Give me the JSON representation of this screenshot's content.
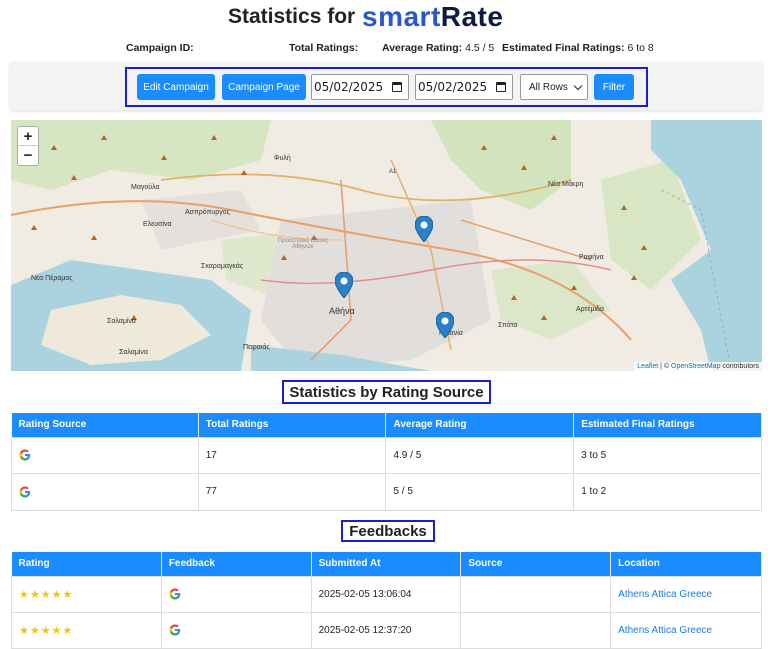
{
  "header": {
    "title": "Statistics for",
    "logo_smart": "smart",
    "logo_rate": "Rate"
  },
  "summary": {
    "campaign_id_label": "Campaign ID:",
    "campaign_id_value": "",
    "total_ratings_label": "Total Ratings:",
    "total_ratings_value": "",
    "average_rating_label": "Average Rating:",
    "average_rating_value": "4.5 / 5",
    "estimated_final_label": "Estimated Final Ratings:",
    "estimated_final_value": "6 to 8"
  },
  "controls": {
    "edit_campaign": "Edit Campaign",
    "campaign_page": "Campaign Page",
    "date_from": "05/02/2025",
    "date_to": "05/02/2025",
    "rows_select": "All Rows",
    "filter": "Filter"
  },
  "map": {
    "zoom_in": "+",
    "zoom_out": "−",
    "attribution_leaflet": "Leaflet",
    "attribution_sep": " | © ",
    "attribution_osm": "OpenStreetMap",
    "attribution_contrib": " contributors",
    "labels": {
      "fyli": "Φυλή",
      "magoula": "Μαγούλα",
      "aspropyrgos": "Ασπρόπυργος",
      "elefsina": "Ελευσίνα",
      "skaramagkas": "Σκαραμαγκάς",
      "nea_peramos": "Νέα Πέραμος",
      "salamina1": "Σαλαμίνα",
      "salamina2": "Σαλαμίνα",
      "peiraias": "Πειραιάς",
      "athina": "Αθήνα",
      "paiania": "Παιανία",
      "spata": "Σπάτα",
      "artemida": "Αρτέμιδα",
      "rafina": "Ραφήνα",
      "nea_makri": "Νέα Μάκρη",
      "forest": "Προαστιακό Δάσος Αθηνών",
      "a1": "A1"
    }
  },
  "sources_section": {
    "title": "Statistics by Rating Source",
    "columns": [
      "Rating Source",
      "Total Ratings",
      "Average Rating",
      "Estimated Final Ratings"
    ],
    "rows": [
      {
        "source_icon": "google-icon",
        "total": "17",
        "average": "4.9 / 5",
        "estimated": "3 to 5"
      },
      {
        "source_icon": "google-icon",
        "total": "77",
        "average": "5 / 5",
        "estimated": "1 to 2"
      }
    ]
  },
  "feedbacks_section": {
    "title": "Feedbacks",
    "columns": [
      "Rating",
      "Feedback",
      "Submitted At",
      "Source",
      "Location"
    ],
    "rows": [
      {
        "rating": "★★★★★",
        "feedback_icon": "google-icon",
        "submitted": "2025-02-05 13:06:04",
        "source": "",
        "location": "Athens Attica Greece"
      },
      {
        "rating": "★★★★★",
        "feedback_icon": "google-icon",
        "submitted": "2025-02-05 12:37:20",
        "source": "",
        "location": "Athens Attica Greece"
      }
    ]
  },
  "colors": {
    "accent": "#1a8cff",
    "highlight_border": "#1b1bd4",
    "star": "#f5c400",
    "link": "#1a7ce0"
  }
}
